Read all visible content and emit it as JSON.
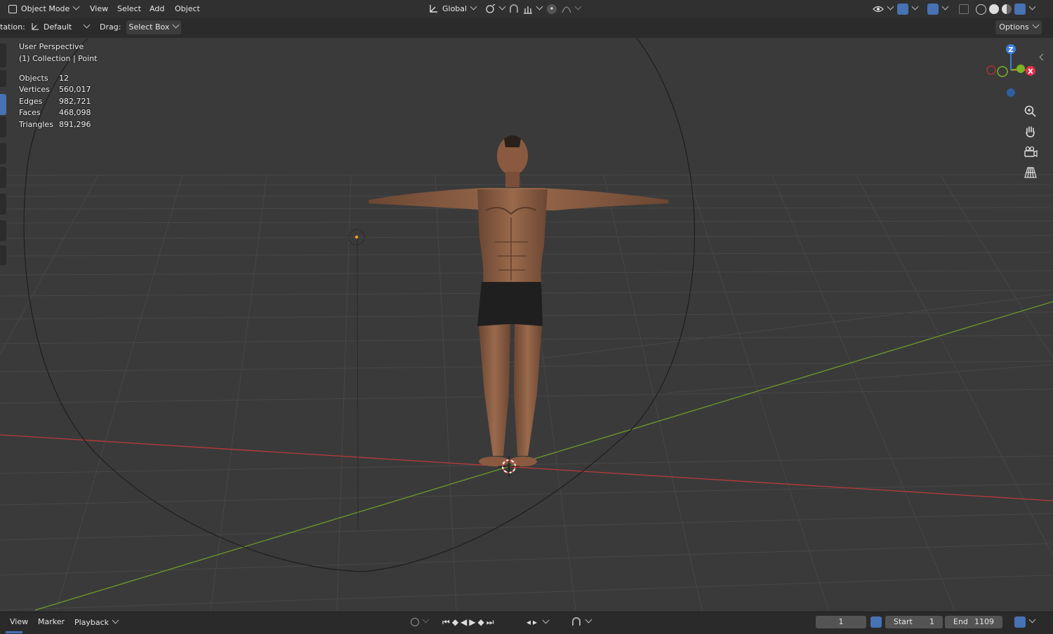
{
  "header": {
    "mode_label": "Object Mode",
    "menus": [
      "View",
      "Select",
      "Add",
      "Object"
    ],
    "transform_orientation": "Global"
  },
  "toolrow": {
    "orientation_label": "tation:",
    "orientation_value": "Default",
    "drag_label": "Drag:",
    "drag_value": "Select Box",
    "options_label": "Options"
  },
  "overlay": {
    "view_name": "User Perspective",
    "collection_info": "(1) Collection | Point",
    "stats": [
      {
        "label": "Objects",
        "value": "12"
      },
      {
        "label": "Vertices",
        "value": "560,017"
      },
      {
        "label": "Edges",
        "value": "982,721"
      },
      {
        "label": "Faces",
        "value": "468,098"
      },
      {
        "label": "Triangles",
        "value": "891,296"
      }
    ]
  },
  "gizmo": {
    "z": "Z",
    "x": "X",
    "colors": {
      "x": "#e0304a",
      "y": "#7ab326",
      "z": "#3e7fd6"
    }
  },
  "timeline": {
    "menus": [
      "View",
      "Marker",
      "Playback"
    ],
    "current_frame": "1",
    "start_label": "Start",
    "start_value": "1",
    "end_label": "End",
    "end_value": "1109"
  },
  "colors": {
    "accent": "#4772b3",
    "x_axis": "#b83a3a",
    "y_axis": "#6e9a2a",
    "background": "#3a3a3a"
  }
}
